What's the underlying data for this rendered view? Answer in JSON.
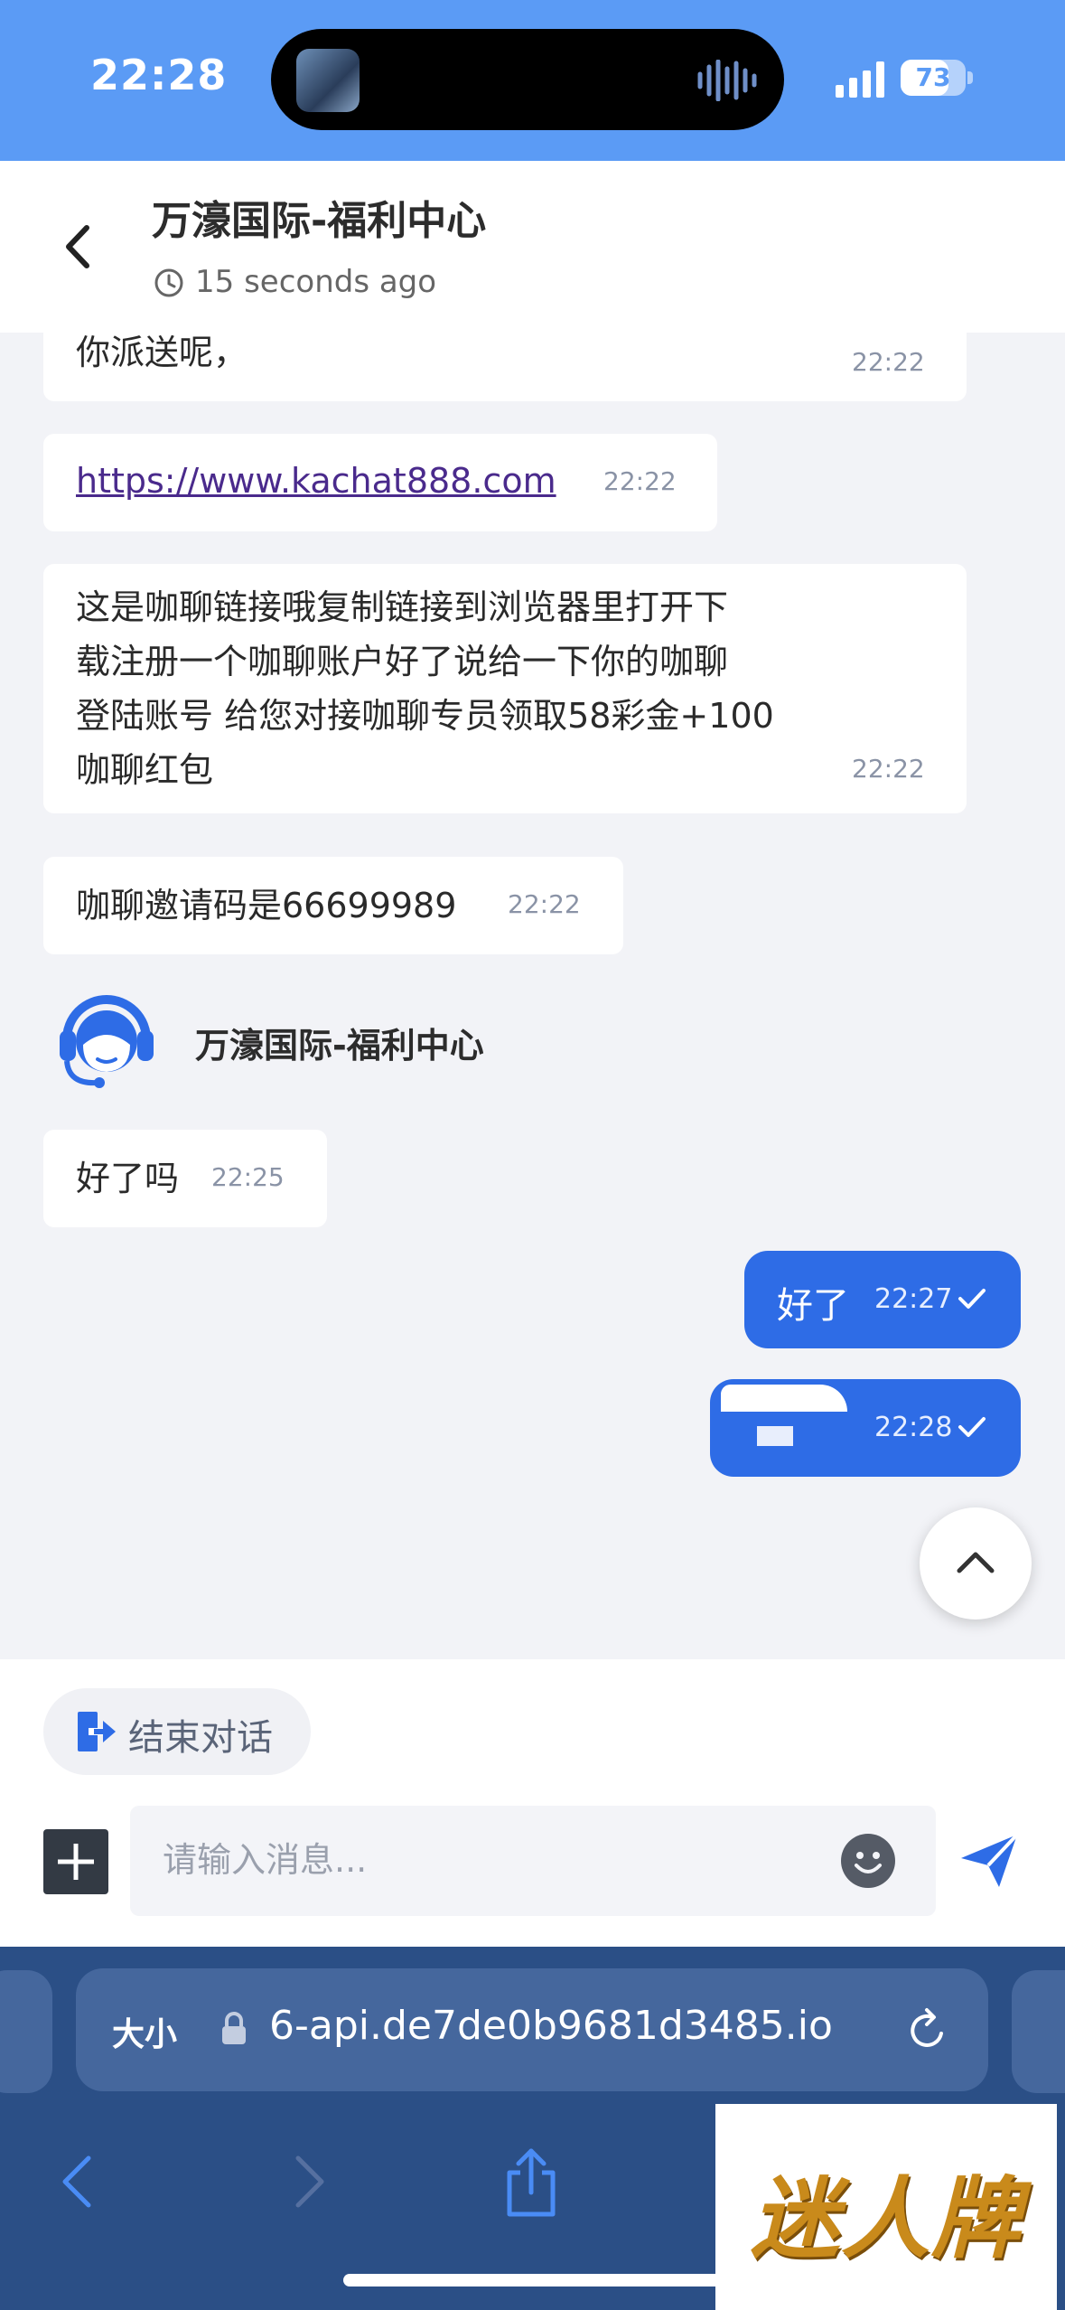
{
  "status_bar": {
    "time": "22:28",
    "battery": "73",
    "battery_fraction": 0.73
  },
  "header": {
    "title": "万濠国际-福利中心",
    "status": "15 seconds ago"
  },
  "messages": [
    {
      "text": "你派送呢，",
      "time": "22:22"
    },
    {
      "text": "https://www.kachat888.com",
      "time": "22:22"
    },
    {
      "text": "这是咖聊链接哦复制链接到浏览器里打开下\n载注册一个咖聊账户好了说给一下你的咖聊\n登陆账号 给您对接咖聊专员领取58彩金+100\n咖聊红包",
      "time": "22:22"
    },
    {
      "text": "咖聊邀请码是66699989",
      "time": "22:22"
    },
    {
      "text": "好了吗",
      "time": "22:25"
    }
  ],
  "agent": {
    "name": "万濠国际-福利中心",
    "icon": "headset-agent-icon"
  },
  "sent_messages": [
    {
      "text": "好了",
      "time": "22:27"
    },
    {
      "text": "",
      "time": "22:28"
    }
  ],
  "composer": {
    "end_chat_label": "结束对话",
    "input_placeholder": "请输入消息..."
  },
  "browser": {
    "aa_label": "大小",
    "url": "6-api.de7de0b9681d3485.io"
  },
  "watermark": {
    "text": "迷人牌"
  },
  "colors": {
    "status_bar_bg": "#5b9bf5",
    "outgoing_bubble": "#2e6ce6",
    "browser_bg": "#2b4f86"
  }
}
